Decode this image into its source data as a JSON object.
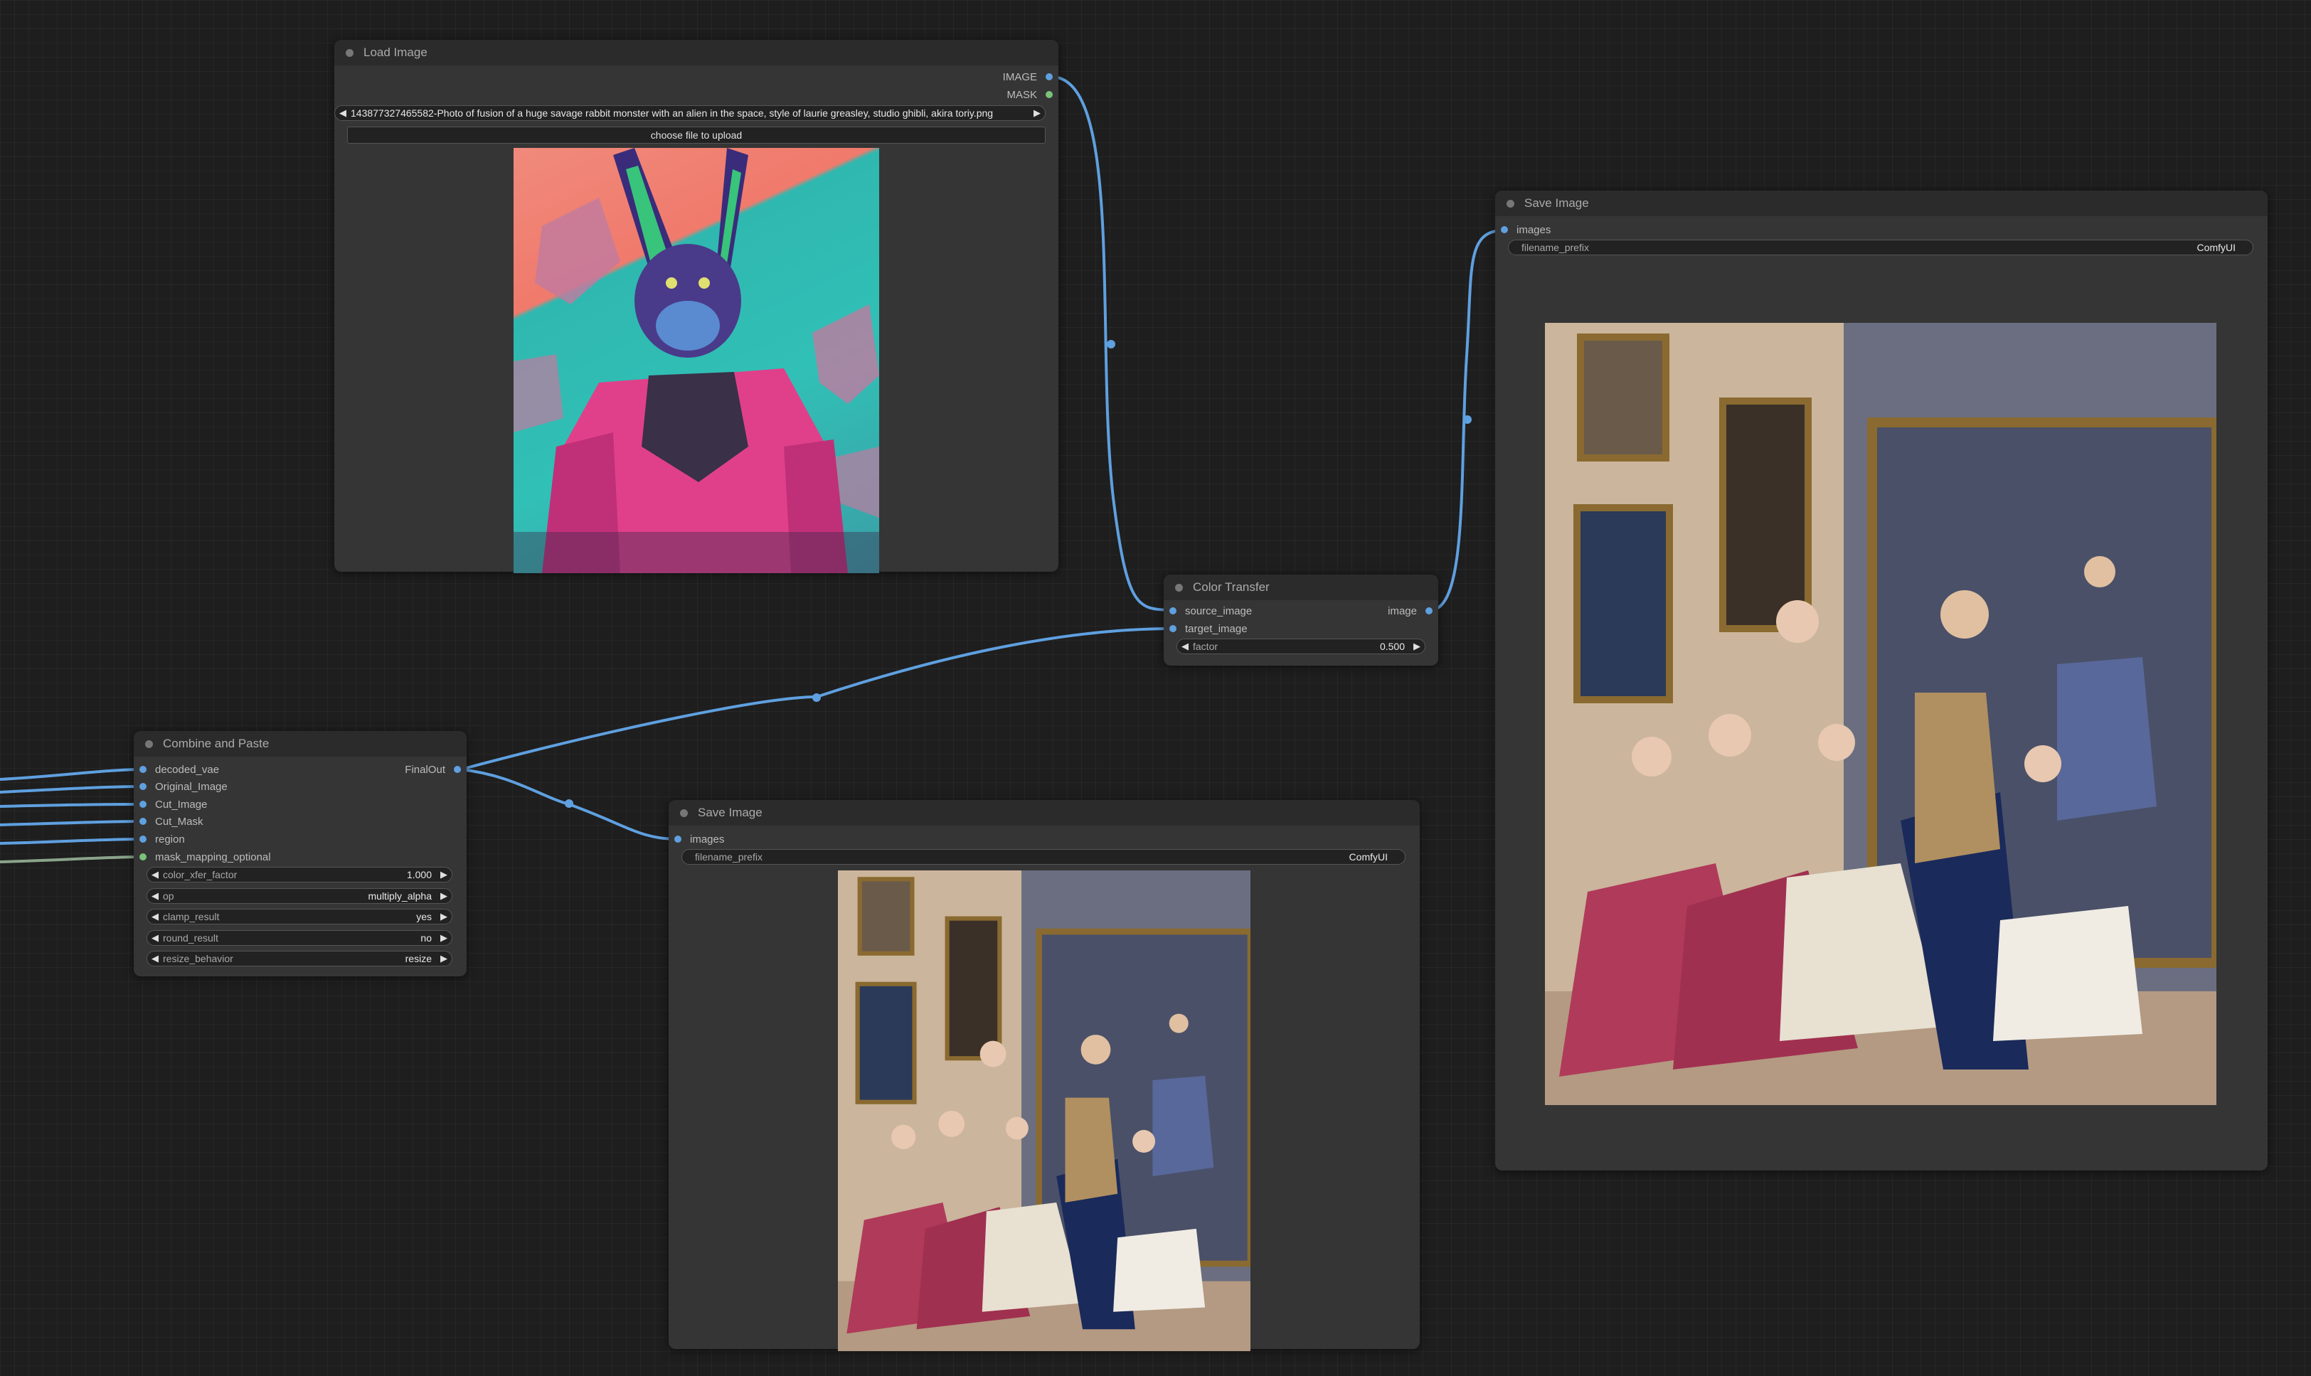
{
  "nodes": {
    "load_image": {
      "title": "Load Image",
      "outputs": [
        "IMAGE",
        "MASK"
      ],
      "image_widget": {
        "value": "143877327465582-Photo of fusion of a huge savage rabbit monster with an alien in the space, style of laurie greasley, studio ghibli, akira toriy.png",
        "left_arrow": "◀",
        "right_arrow": "▶"
      },
      "upload_button": "choose file to upload",
      "colors": {
        "sky_coral": "#f08a7c",
        "sky_teal": "#31c0b6",
        "armor_pink": "#e0408a",
        "fur_violet": "#4a3a8a"
      }
    },
    "color_transfer": {
      "title": "Color Transfer",
      "inputs": [
        "source_image",
        "target_image"
      ],
      "output": "image",
      "widgets": [
        {
          "label": "factor",
          "value": "0.500"
        }
      ]
    },
    "save_image_right": {
      "title": "Save Image",
      "input": "images",
      "widgets": [
        {
          "label": "filename_prefix",
          "value": "ComfyUI"
        }
      ]
    },
    "combine_and_paste": {
      "title": "Combine and Paste",
      "inputs": [
        "decoded_vae",
        "Original_Image",
        "Cut_Image",
        "Cut_Mask",
        "region",
        "mask_mapping_optional"
      ],
      "output": "FinalOut",
      "widgets": [
        {
          "label": "color_xfer_factor",
          "value": "1.000"
        },
        {
          "label": "op",
          "value": "multiply_alpha"
        },
        {
          "label": "clamp_result",
          "value": "yes"
        },
        {
          "label": "round_result",
          "value": "no"
        },
        {
          "label": "resize_behavior",
          "value": "resize"
        }
      ]
    },
    "save_image_bottom": {
      "title": "Save Image",
      "input": "images",
      "widgets": [
        {
          "label": "filename_prefix",
          "value": "ComfyUI"
        }
      ]
    }
  },
  "arrows": {
    "left": "◀",
    "right": "▶"
  },
  "colors": {
    "canvas": "#1e1e1e",
    "node_body": "#353535",
    "node_title": "#2b2b2b",
    "link_image": "#5fa0e0",
    "link_mask": "#7ac27a"
  }
}
